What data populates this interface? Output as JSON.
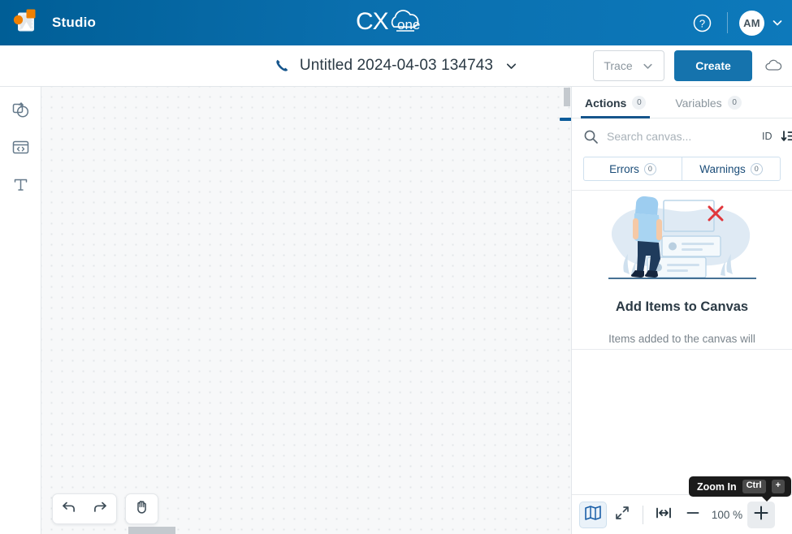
{
  "header": {
    "app_name": "Studio",
    "logo_icon": "studio-logo-icon",
    "brand_logo": "cxone-logo",
    "brand_text_primary": "CX",
    "brand_text_secondary": "one",
    "help_icon": "help-circle-icon",
    "avatar_initials": "AM",
    "avatar_caret_icon": "chevron-down-icon"
  },
  "toolbar": {
    "script_type_icon": "phone-icon",
    "script_title": "Untitled 2024-04-03 134743",
    "title_caret_icon": "chevron-down-icon",
    "trace_label": "Trace",
    "trace_caret_icon": "chevron-down-icon",
    "create_label": "Create",
    "cloud_icon": "cloud-icon"
  },
  "left_rail": {
    "items": [
      {
        "name": "shapes-tool",
        "icon": "shapes-icon"
      },
      {
        "name": "snippet-tool",
        "icon": "code-window-icon"
      },
      {
        "name": "text-tool",
        "icon": "text-t-icon"
      }
    ]
  },
  "canvas": {
    "undo_icon": "undo-arrow-icon",
    "redo_icon": "redo-arrow-icon",
    "pan_icon": "hand-pan-icon"
  },
  "right_panel": {
    "tabs": [
      {
        "label": "Actions",
        "count": "0",
        "active": true
      },
      {
        "label": "Variables",
        "count": "0",
        "active": false
      }
    ],
    "search": {
      "icon": "search-icon",
      "placeholder": "Search canvas...",
      "value": "",
      "sort_label": "ID",
      "sort_icon": "sort-descending-icon"
    },
    "filters": [
      {
        "label": "Errors",
        "count": "0"
      },
      {
        "label": "Warnings",
        "count": "0"
      }
    ],
    "empty_state": {
      "illustration": "person-empty-canvas-illustration",
      "title": "Add Items to Canvas",
      "description": "Items added to the canvas will"
    }
  },
  "zoom_bar": {
    "minimap_icon": "minimap-book-icon",
    "fullscreen_icon": "expand-arrows-icon",
    "fit_width_icon": "fit-width-icon",
    "zoom_out_icon": "minus-icon",
    "zoom_level": "100 %",
    "zoom_in_icon": "plus-icon",
    "tooltip": {
      "text": "Zoom In",
      "key_modifier": "Ctrl",
      "key_main": "+"
    }
  },
  "colors": {
    "header_blue": "#0a6fae",
    "accent_blue": "#1573ad",
    "tab_underline": "#15558c",
    "canvas_bg": "#f7f8f9",
    "error_red": "#e0373c"
  }
}
